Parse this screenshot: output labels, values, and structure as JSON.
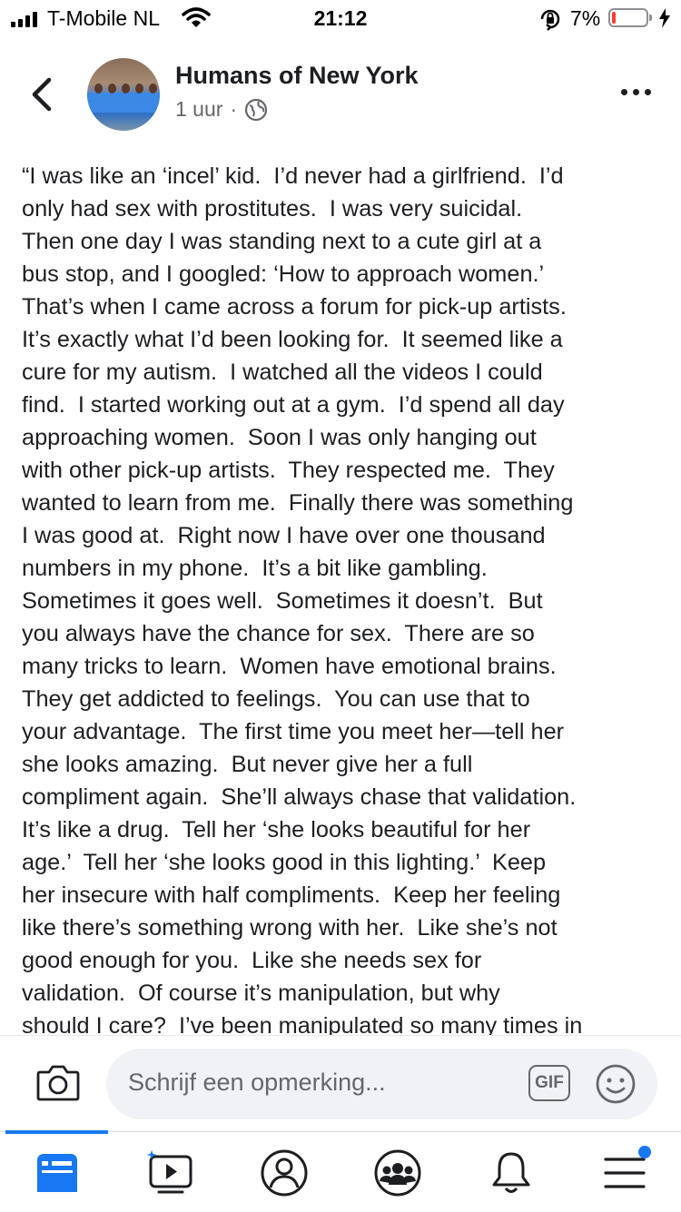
{
  "status_bar": {
    "carrier": "T-Mobile NL",
    "time": "21:12",
    "battery_percent": "7%",
    "battery_level": 0.07,
    "icons": [
      "signal-icon",
      "wifi-icon",
      "orientation-lock-icon",
      "battery-icon",
      "charging-icon"
    ]
  },
  "post": {
    "page_name": "Humans of New York",
    "time_ago": "1 uur",
    "separator": "·",
    "audience_icon": "globe-icon",
    "lines": [
      "“I was like an ‘incel’ kid.  I’d never had a girlfriend.  I’d",
      "only had sex with prostitutes.  I was very suicidal.",
      "Then one day I was standing next to a cute girl at a",
      "bus stop, and I googled: ‘How to approach women.’",
      "That’s when I came across a forum for pick-up artists.",
      "It’s exactly what I’d been looking for.  It seemed like a",
      "cure for my autism.  I watched all the videos I could",
      "find.  I started working out at a gym.  I’d spend all day",
      "approaching women.  Soon I was only hanging out",
      "with other pick-up artists.  They respected me.  They",
      "wanted to learn from me.  Finally there was something",
      "I was good at.  Right now I have over one thousand",
      "numbers in my phone.  It’s a bit like gambling.",
      "Sometimes it goes well.  Sometimes it doesn’t.  But",
      "you always have the chance for sex.  There are so",
      "many tricks to learn.  Women have emotional brains.",
      "They get addicted to feelings.  You can use that to",
      "your advantage.  The first time you meet her—tell her",
      "she looks amazing.  But never give her a full",
      "compliment again.  She’ll always chase that validation.",
      "It’s like a drug.  Tell her ‘she looks beautiful for her",
      "age.’  Tell her ‘she looks good in this lighting.’  Keep",
      "her insecure with half compliments.  Keep her feeling",
      "like there’s something wrong with her.  Like she’s not",
      "good enough for you.  Like she needs sex for",
      "validation.  Of course it’s manipulation, but why",
      "should I care?  I’ve been manipulated so many times in"
    ]
  },
  "comment_bar": {
    "placeholder": "Schrijf een opmerking...",
    "gif_label": "GIF",
    "camera_icon": "camera-icon",
    "emoji_icon": "smiley-icon"
  },
  "tab_bar": {
    "active_tab": "news-feed",
    "tabs": [
      "news-feed-icon",
      "watch-icon",
      "profile-icon",
      "groups-icon",
      "notifications-icon",
      "menu-icon"
    ]
  }
}
